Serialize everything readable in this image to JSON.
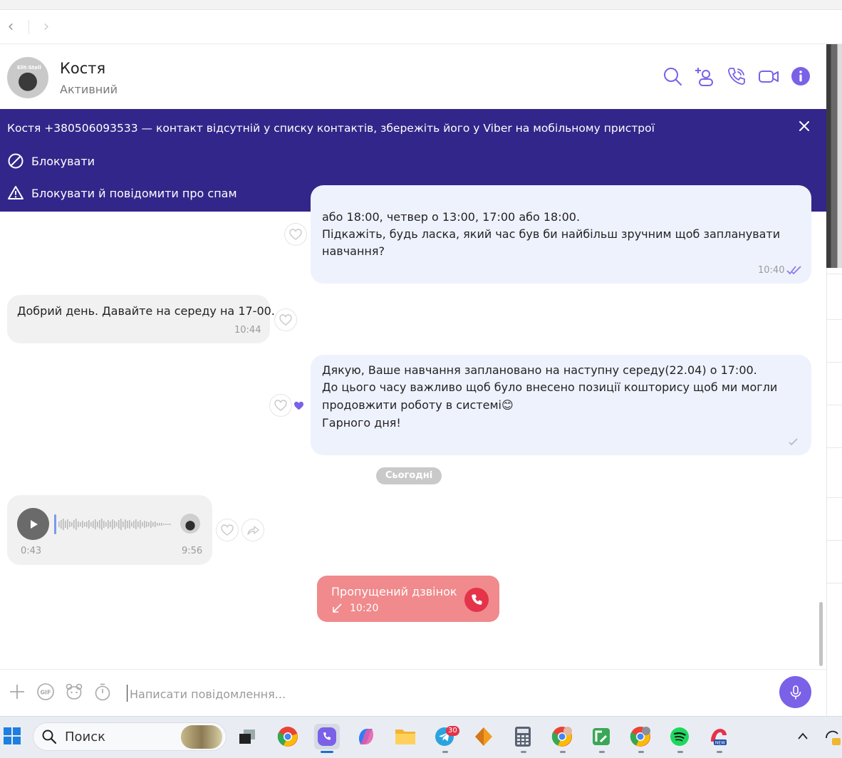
{
  "contact": {
    "name": "Костя",
    "status": "Активний"
  },
  "header_icons": [
    "search-icon",
    "add-participant-icon",
    "audio-call-icon",
    "video-call-icon",
    "info-icon"
  ],
  "banner": {
    "text": "Костя +380506093533 — контакт відсутній у списку контактів, збережіть його у Viber на мобільному пристрої",
    "block_label": "Блокувати",
    "block_spam_label": "Блокувати й повідомити про спам"
  },
  "messages": {
    "m1": {
      "line1": "або 18:00, четвер о 13:00, 17:00 або 18:00.",
      "line2": "Підкажіть, будь ласка, який час був би найбільш зручним щоб запланувати",
      "line3": "навчання?",
      "time": "10:40"
    },
    "m2": {
      "text": "Добрий день. Давайте на середу на 17-00.",
      "time": "10:44"
    },
    "m3": {
      "line1": "Дякую, Ваше навчання заплановано на наступну середу(22.04) о 17:00.",
      "line2": "До цього часу важливо щоб було внесено позиції кошторису щоб ми могли",
      "line3": "продовжити роботу в системі",
      "emoji": "😊",
      "line4": "Гарного дня!"
    },
    "date_separator": "Сьогодні",
    "voice": {
      "elapsed": "0:43",
      "time": "9:56"
    },
    "missed_call": {
      "label": "Пропущений дзвінок",
      "time": "10:20"
    }
  },
  "composer": {
    "placeholder": "Написати повідомлення..."
  },
  "taskbar": {
    "search_label": "Поиск",
    "telegram_badge": "30"
  },
  "colors": {
    "banner": "#33268a",
    "accent": "#7a61e8",
    "outgoing_bubble": "#eef2fd",
    "incoming_bubble": "#f1f1f1",
    "missed_call": "#f08a8c",
    "missed_call_button": "#e5334a"
  }
}
